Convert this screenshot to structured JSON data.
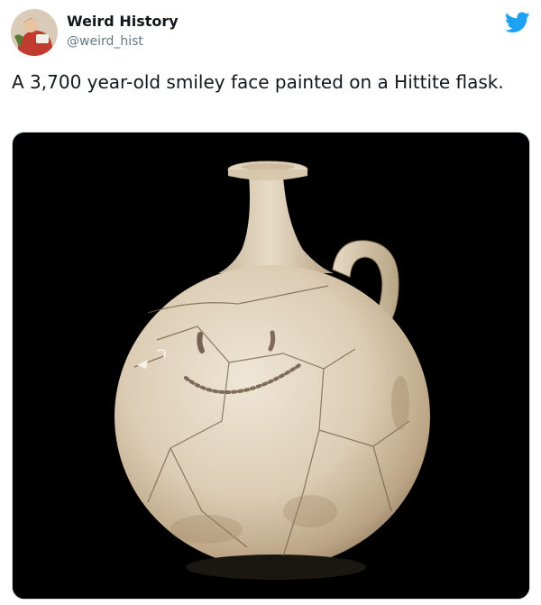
{
  "author": {
    "name": "Weird History",
    "handle": "@weird_hist",
    "avatar": "avatar-photo"
  },
  "brand": {
    "icon": "twitter-bird-icon",
    "color": "#1da1f2"
  },
  "tweet": {
    "text": "A 3,700 year-old smiley face painted on a Hittite flask."
  },
  "media": {
    "subject": "hittite-flask-photo",
    "background": "#000000"
  }
}
